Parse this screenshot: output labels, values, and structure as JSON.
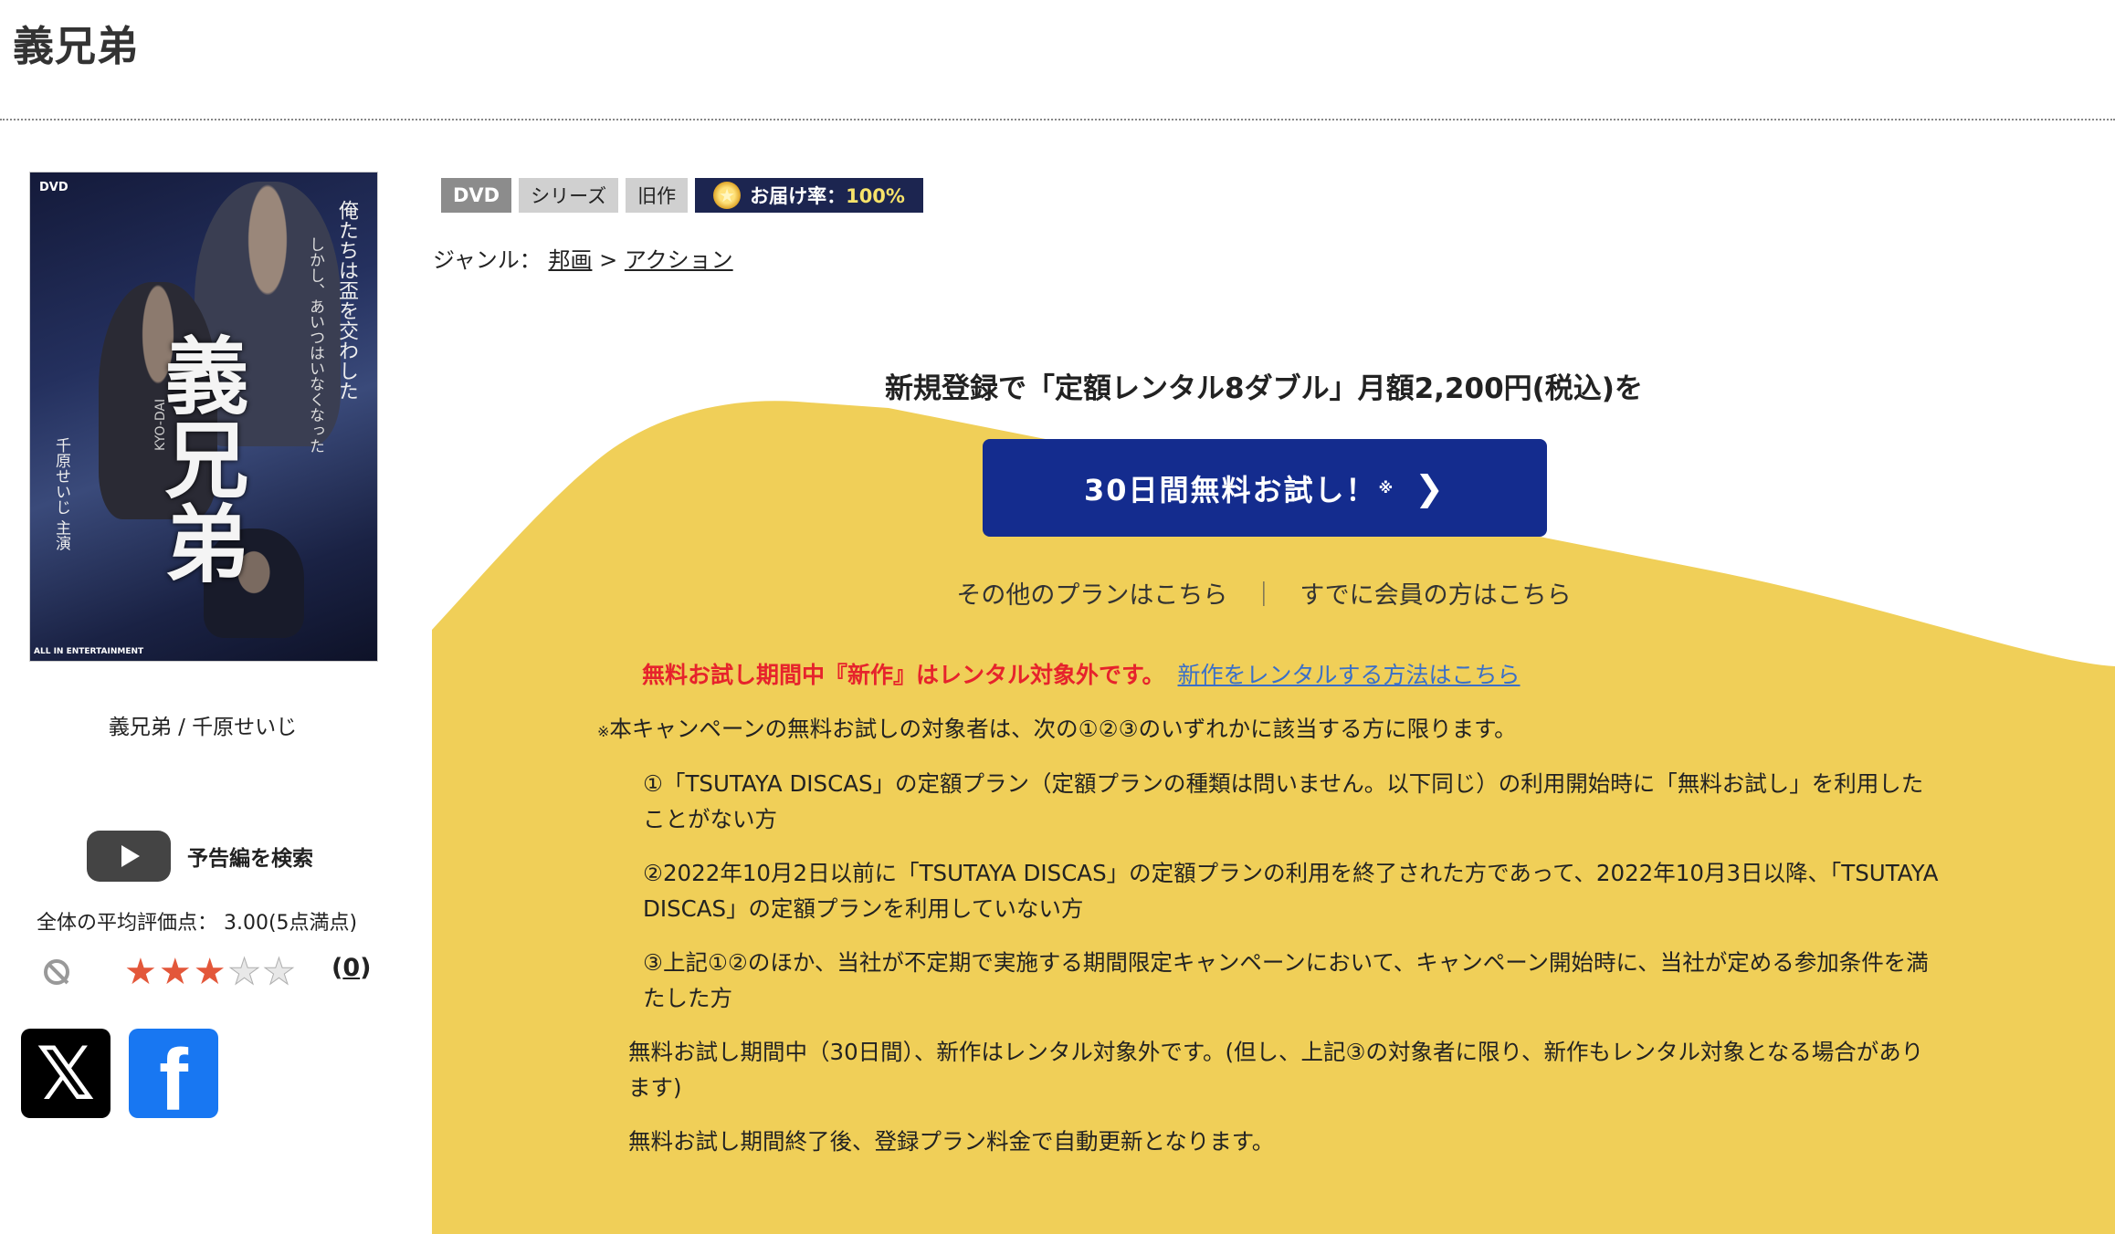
{
  "page": {
    "title": "義兄弟"
  },
  "product": {
    "caption": "義兄弟 / 千原せいじ",
    "cover": {
      "dvd_mark": "DVD",
      "title": "義兄弟",
      "romaji": "KYO-DAI",
      "tagline_1": "俺たちは盃を交わした",
      "tagline_2": "しかし、あいつはいなくなった",
      "cast": "千原せいじ 主演",
      "label": "ALL IN ENTERTAINMENT"
    },
    "trailer_label": "予告編を検索",
    "average_rating_text": "全体の平均評価点： 3.00(5点満点)",
    "rating_value": 3,
    "rating_max": 5,
    "review_count_open": "(",
    "review_count": "0",
    "review_count_close": ")"
  },
  "share": {
    "x_icon": "x-logo-icon",
    "x_glyph": "𝕏",
    "facebook_icon": "facebook-logo-icon",
    "facebook_glyph": "f"
  },
  "tags": {
    "dvd": "DVD",
    "series": "シリーズ",
    "old": "旧作",
    "delivery_label": "お届け率：",
    "delivery_rate": "100%"
  },
  "genre": {
    "label": "ジャンル：",
    "level1": "邦画",
    "separator": ">",
    "level2": "アクション"
  },
  "campaign": {
    "headline": "新規登録で「定額レンタル8ダブル」月額2,200円(税込)を",
    "cta_label": "30日間無料お試し！",
    "cta_note": "※",
    "other_plans": "その他のプランはこちら",
    "separator": "｜",
    "members": "すでに会員の方はこちら",
    "warning": "無料お試し期間中『新作』はレンタル対象外です。",
    "warning_link": "新作をレンタルする方法はこちら",
    "note_mark": "※",
    "note_intro": "本キャンペーンの無料お試しの対象者は、次の①②③のいずれかに該当する方に限ります。",
    "condition_1": "①「TSUTAYA DISCAS」の定額プラン（定額プランの種類は問いません。以下同じ）の利用開始時に「無料お試し」を利用したことがない方",
    "condition_2": "②2022年10月2日以前に「TSUTAYA DISCAS」の定額プランの利用を終了された方であって、2022年10月3日以降、「TSUTAYA DISCAS」の定額プランを利用していない方",
    "condition_3": "③上記①②のほか、当社が不定期で実施する期間限定キャンペーンにおいて、キャンペーン開始時に、当社が定める参加条件を満たした方",
    "trial_note": "無料お試し期間中（30日間）、新作はレンタル対象外です。(但し、上記③の対象者に限り、新作もレンタル対象となる場合があります)",
    "renewal_note": "無料お試し期間終了後、登録プラン料金で自動更新となります。"
  },
  "colors": {
    "campaign_bg": "#f0cf58",
    "cta_bg": "#142c8e",
    "warning": "#e6232c",
    "link": "#3a6fc8",
    "delivery_tag_bg": "#1c2550"
  }
}
